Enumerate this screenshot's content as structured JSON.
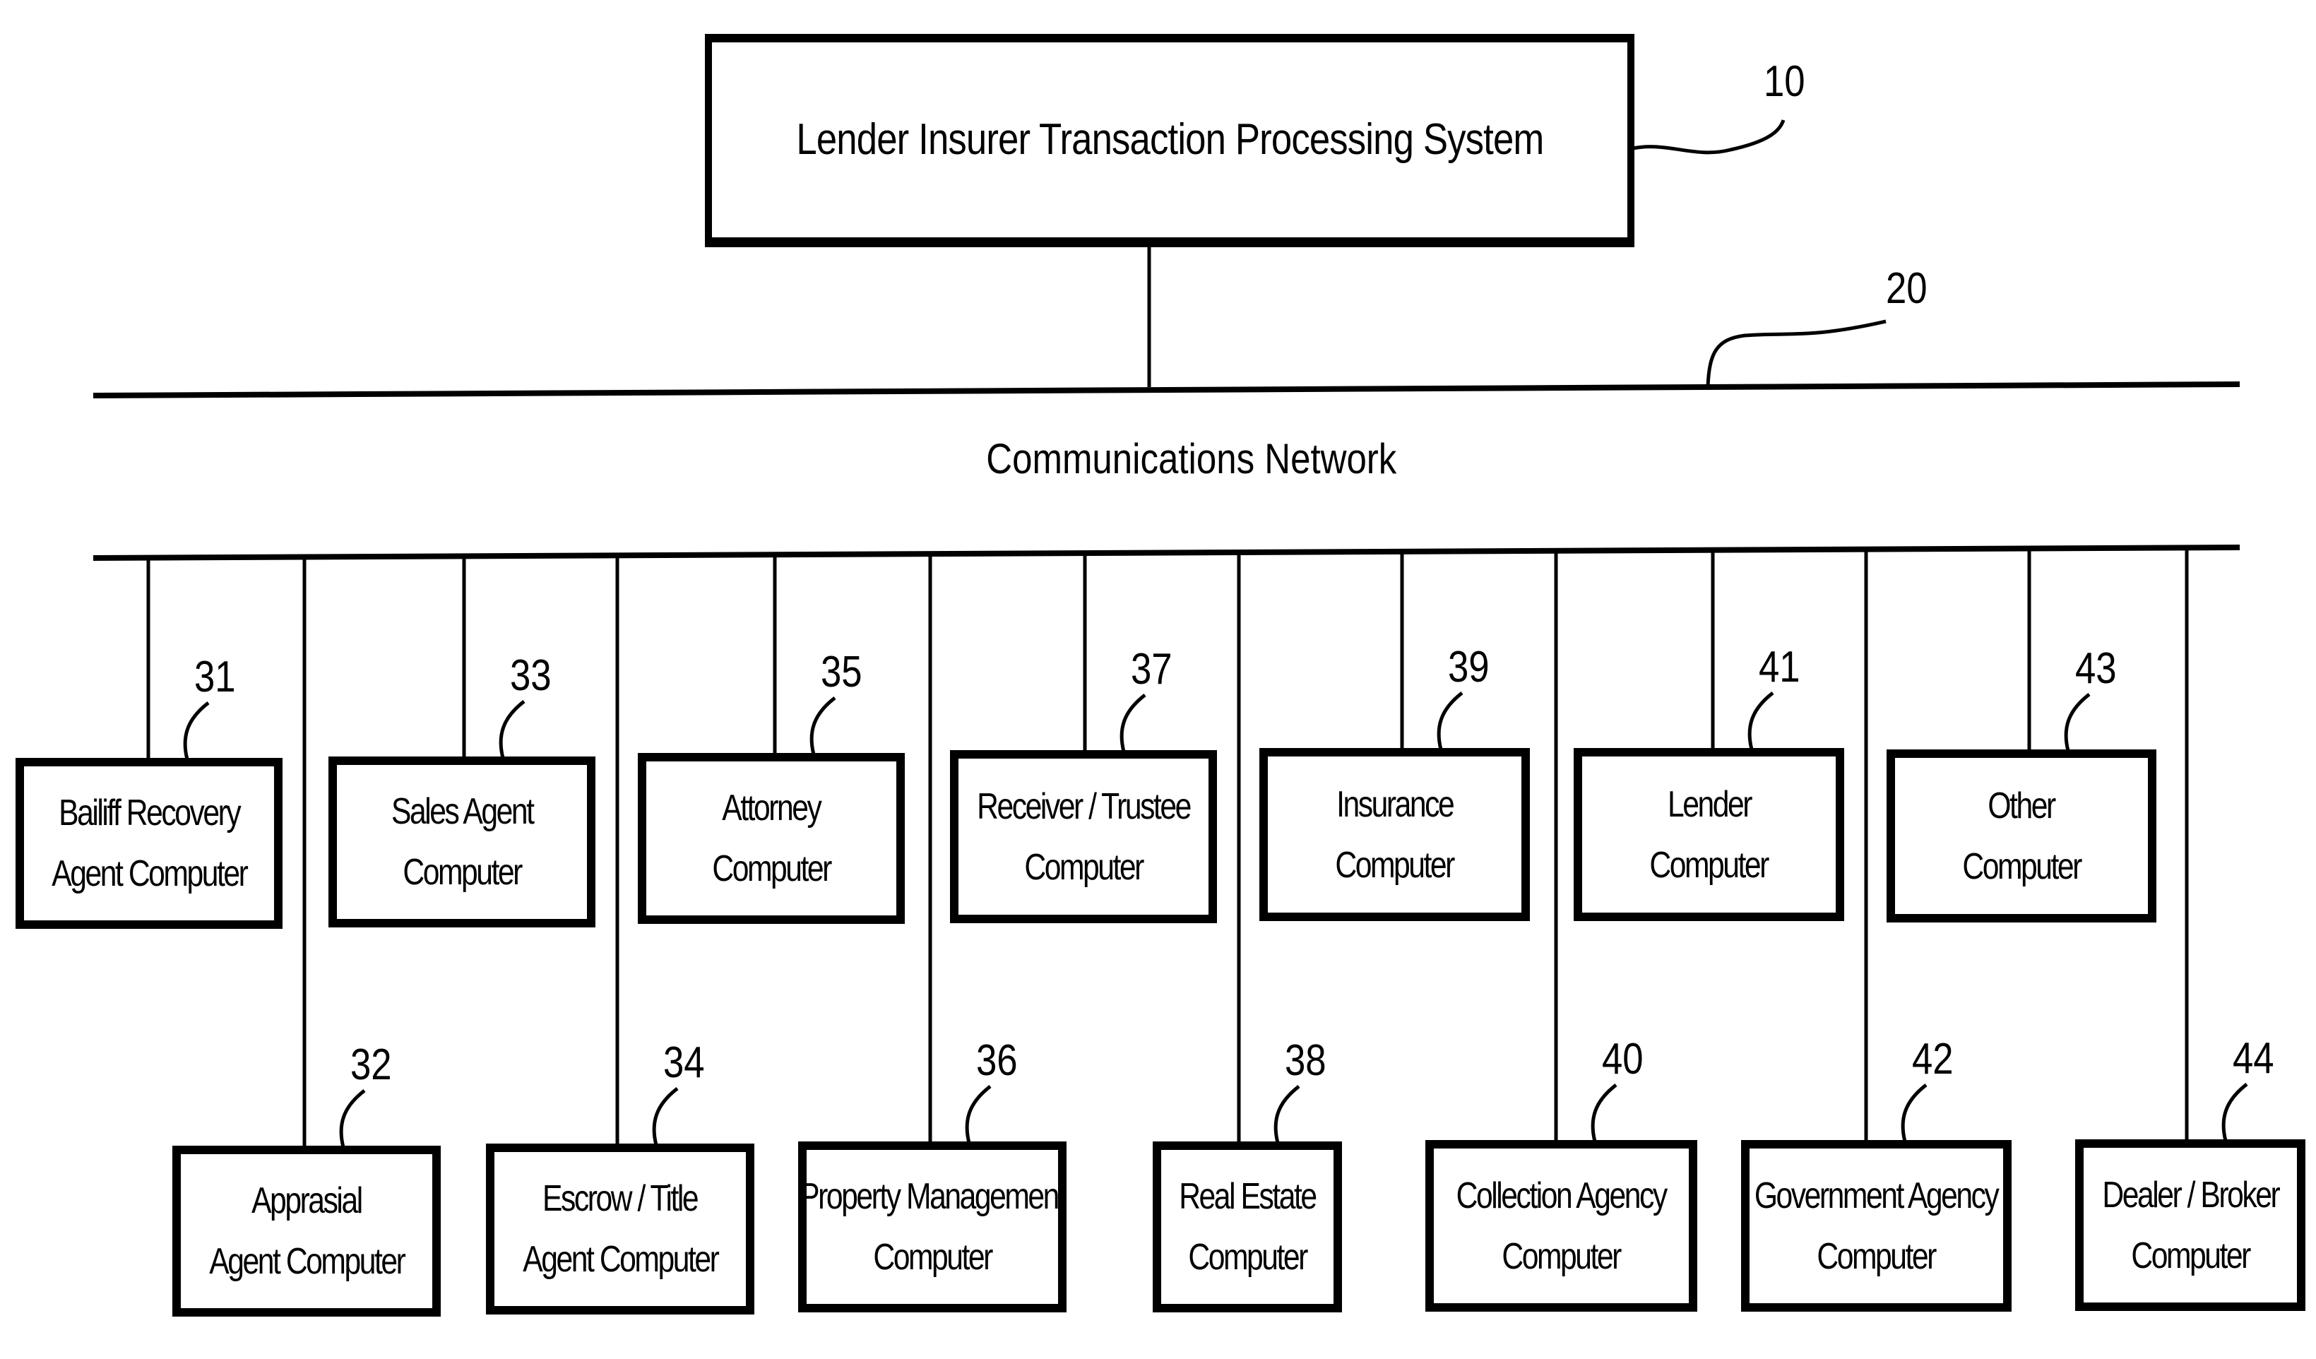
{
  "diagram": {
    "main_system": {
      "label": "Lender Insurer Transaction Processing System",
      "ref": "10"
    },
    "network": {
      "label": "Communications Network",
      "ref": "20"
    },
    "top_row": [
      {
        "ref": "31",
        "lines": [
          "Bailiff Recovery",
          "Agent Computer"
        ]
      },
      {
        "ref": "33",
        "lines": [
          "Sales Agent",
          "Computer"
        ]
      },
      {
        "ref": "35",
        "lines": [
          "Attorney",
          "Computer"
        ]
      },
      {
        "ref": "37",
        "lines": [
          "Receiver / Trustee",
          "Computer"
        ]
      },
      {
        "ref": "39",
        "lines": [
          "Insurance",
          "Computer"
        ]
      },
      {
        "ref": "41",
        "lines": [
          "Lender",
          "Computer"
        ]
      },
      {
        "ref": "43",
        "lines": [
          "Other",
          "Computer"
        ]
      }
    ],
    "bottom_row": [
      {
        "ref": "32",
        "lines": [
          "Apprasial",
          "Agent Computer"
        ]
      },
      {
        "ref": "34",
        "lines": [
          "Escrow / Title",
          "Agent Computer"
        ]
      },
      {
        "ref": "36",
        "lines": [
          "Property Management",
          "Computer"
        ]
      },
      {
        "ref": "38",
        "lines": [
          "Real Estate",
          "Computer"
        ]
      },
      {
        "ref": "40",
        "lines": [
          "Collection Agency",
          "Computer"
        ]
      },
      {
        "ref": "42",
        "lines": [
          "Government Agency",
          "Computer"
        ]
      },
      {
        "ref": "44",
        "lines": [
          "Dealer / Broker",
          "Computer"
        ]
      }
    ]
  }
}
